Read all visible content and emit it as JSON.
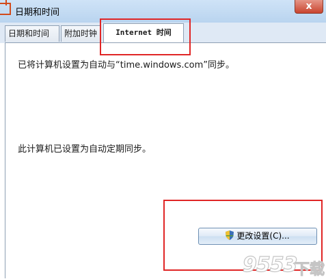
{
  "window": {
    "title": "日期和时间",
    "close_label": "x"
  },
  "tabs": [
    {
      "label": "日期和时间",
      "active": false
    },
    {
      "label": "附加时钟",
      "active": false
    },
    {
      "label": "Internet 时间",
      "active": true
    }
  ],
  "content": {
    "sync_status": "已将计算机设置为自动与“time.windows.com”同步。",
    "schedule_status": "此计算机已设置为自动定期同步。"
  },
  "buttons": {
    "change_settings": "更改设置(C)..."
  },
  "watermark": {
    "number": "9553",
    "text": "下载"
  },
  "colors": {
    "highlight": "#e02525",
    "titlebar": "#b9d4ef"
  }
}
